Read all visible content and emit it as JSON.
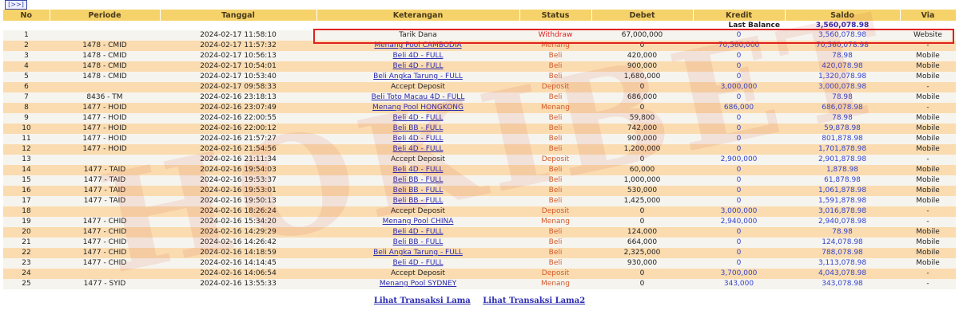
{
  "nav": {
    "label": "[>>]"
  },
  "columns": [
    "No",
    "Periode",
    "Tanggal",
    "Keterangan",
    "Status",
    "Debet",
    "Kredit",
    "Saldo",
    "Via"
  ],
  "last_balance": {
    "label": "Last Balance",
    "value": "3,560,078.98"
  },
  "rows": [
    {
      "no": "1",
      "periode": "",
      "tanggal": "2024-02-17 11:58:10",
      "ket": "Tarik Dana",
      "link": false,
      "status": "Withdraw",
      "debet": "67,000,000",
      "kredit": "0",
      "saldo": "3,560,078.98",
      "via": "Website"
    },
    {
      "no": "2",
      "periode": "1478 - CMID",
      "tanggal": "2024-02-17 11:57:32",
      "ket": "Menang Pool CAMBODIA",
      "link": true,
      "status": "Menang",
      "debet": "0",
      "kredit": "70,560,000",
      "saldo": "70,560,078.98",
      "via": "-"
    },
    {
      "no": "3",
      "periode": "1478 - CMID",
      "tanggal": "2024-02-17 10:56:13",
      "ket": "Beli 4D - FULL",
      "link": true,
      "status": "Beli",
      "debet": "420,000",
      "kredit": "0",
      "saldo": "78.98",
      "via": "Mobile"
    },
    {
      "no": "4",
      "periode": "1478 - CMID",
      "tanggal": "2024-02-17 10:54:01",
      "ket": "Beli 4D - FULL",
      "link": true,
      "status": "Beli",
      "debet": "900,000",
      "kredit": "0",
      "saldo": "420,078.98",
      "via": "Mobile"
    },
    {
      "no": "5",
      "periode": "1478 - CMID",
      "tanggal": "2024-02-17 10:53:40",
      "ket": "Beli Angka Tarung - FULL",
      "link": true,
      "status": "Beli",
      "debet": "1,680,000",
      "kredit": "0",
      "saldo": "1,320,078.98",
      "via": "Mobile"
    },
    {
      "no": "6",
      "periode": "",
      "tanggal": "2024-02-17 09:58:33",
      "ket": "Accept Deposit",
      "link": false,
      "status": "Deposit",
      "debet": "0",
      "kredit": "3,000,000",
      "saldo": "3,000,078.98",
      "via": "-"
    },
    {
      "no": "7",
      "periode": "8436 - TM",
      "tanggal": "2024-02-16 23:18:13",
      "ket": "Beli Toto Macau 4D - FULL",
      "link": true,
      "status": "Beli",
      "debet": "686,000",
      "kredit": "0",
      "saldo": "78.98",
      "via": "Mobile"
    },
    {
      "no": "8",
      "periode": "1477 - HOID",
      "tanggal": "2024-02-16 23:07:49",
      "ket": "Menang Pool HONGKONG",
      "link": true,
      "status": "Menang",
      "debet": "0",
      "kredit": "686,000",
      "saldo": "686,078.98",
      "via": "-"
    },
    {
      "no": "9",
      "periode": "1477 - HOID",
      "tanggal": "2024-02-16 22:00:55",
      "ket": "Beli 4D - FULL",
      "link": true,
      "status": "Beli",
      "debet": "59,800",
      "kredit": "0",
      "saldo": "78.98",
      "via": "Mobile"
    },
    {
      "no": "10",
      "periode": "1477 - HOID",
      "tanggal": "2024-02-16 22:00:12",
      "ket": "Beli BB - FULL",
      "link": true,
      "status": "Beli",
      "debet": "742,000",
      "kredit": "0",
      "saldo": "59,878.98",
      "via": "Mobile"
    },
    {
      "no": "11",
      "periode": "1477 - HOID",
      "tanggal": "2024-02-16 21:57:27",
      "ket": "Beli 4D - FULL",
      "link": true,
      "status": "Beli",
      "debet": "900,000",
      "kredit": "0",
      "saldo": "801,878.98",
      "via": "Mobile"
    },
    {
      "no": "12",
      "periode": "1477 - HOID",
      "tanggal": "2024-02-16 21:54:56",
      "ket": "Beli 4D - FULL",
      "link": true,
      "status": "Beli",
      "debet": "1,200,000",
      "kredit": "0",
      "saldo": "1,701,878.98",
      "via": "Mobile"
    },
    {
      "no": "13",
      "periode": "",
      "tanggal": "2024-02-16 21:11:34",
      "ket": "Accept Deposit",
      "link": false,
      "status": "Deposit",
      "debet": "0",
      "kredit": "2,900,000",
      "saldo": "2,901,878.98",
      "via": "-"
    },
    {
      "no": "14",
      "periode": "1477 - TAID",
      "tanggal": "2024-02-16 19:54:03",
      "ket": "Beli 4D - FULL",
      "link": true,
      "status": "Beli",
      "debet": "60,000",
      "kredit": "0",
      "saldo": "1,878.98",
      "via": "Mobile"
    },
    {
      "no": "15",
      "periode": "1477 - TAID",
      "tanggal": "2024-02-16 19:53:37",
      "ket": "Beli BB - FULL",
      "link": true,
      "status": "Beli",
      "debet": "1,000,000",
      "kredit": "0",
      "saldo": "61,878.98",
      "via": "Mobile"
    },
    {
      "no": "16",
      "periode": "1477 - TAID",
      "tanggal": "2024-02-16 19:53:01",
      "ket": "Beli BB - FULL",
      "link": true,
      "status": "Beli",
      "debet": "530,000",
      "kredit": "0",
      "saldo": "1,061,878.98",
      "via": "Mobile"
    },
    {
      "no": "17",
      "periode": "1477 - TAID",
      "tanggal": "2024-02-16 19:50:13",
      "ket": "Beli BB - FULL",
      "link": true,
      "status": "Beli",
      "debet": "1,425,000",
      "kredit": "0",
      "saldo": "1,591,878.98",
      "via": "Mobile"
    },
    {
      "no": "18",
      "periode": "",
      "tanggal": "2024-02-16 18:26:24",
      "ket": "Accept Deposit",
      "link": false,
      "status": "Deposit",
      "debet": "0",
      "kredit": "3,000,000",
      "saldo": "3,016,878.98",
      "via": "-"
    },
    {
      "no": "19",
      "periode": "1477 - CHID",
      "tanggal": "2024-02-16 15:34:20",
      "ket": "Menang Pool CHINA",
      "link": true,
      "status": "Menang",
      "debet": "0",
      "kredit": "2,940,000",
      "saldo": "2,940,078.98",
      "via": "-"
    },
    {
      "no": "20",
      "periode": "1477 - CHID",
      "tanggal": "2024-02-16 14:29:29",
      "ket": "Beli 4D - FULL",
      "link": true,
      "status": "Beli",
      "debet": "124,000",
      "kredit": "0",
      "saldo": "78.98",
      "via": "Mobile"
    },
    {
      "no": "21",
      "periode": "1477 - CHID",
      "tanggal": "2024-02-16 14:26:42",
      "ket": "Beli BB - FULL",
      "link": true,
      "status": "Beli",
      "debet": "664,000",
      "kredit": "0",
      "saldo": "124,078.98",
      "via": "Mobile"
    },
    {
      "no": "22",
      "periode": "1477 - CHID",
      "tanggal": "2024-02-16 14:18:59",
      "ket": "Beli Angka Tarung - FULL",
      "link": true,
      "status": "Beli",
      "debet": "2,325,000",
      "kredit": "0",
      "saldo": "788,078.98",
      "via": "Mobile"
    },
    {
      "no": "23",
      "periode": "1477 - CHID",
      "tanggal": "2024-02-16 14:14:45",
      "ket": "Beli 4D - FULL",
      "link": true,
      "status": "Beli",
      "debet": "930,000",
      "kredit": "0",
      "saldo": "3,113,078.98",
      "via": "Mobile"
    },
    {
      "no": "24",
      "periode": "",
      "tanggal": "2024-02-16 14:06:54",
      "ket": "Accept Deposit",
      "link": false,
      "status": "Deposit",
      "debet": "0",
      "kredit": "3,700,000",
      "saldo": "4,043,078.98",
      "via": "-"
    },
    {
      "no": "25",
      "periode": "1477 - SYID",
      "tanggal": "2024-02-16 13:55:33",
      "ket": "Menang Pool SYDNEY",
      "link": true,
      "status": "Menang",
      "debet": "0",
      "kredit": "343,000",
      "saldo": "343,078.98",
      "via": "-"
    }
  ],
  "footer": {
    "link1": "Lihat Transaksi Lama",
    "link2": "Lihat Transaksi Lama2"
  },
  "colors": {
    "header": "#f5d36a",
    "row_alt": "#fbdcb0",
    "row": "#f6f4ee",
    "highlight": "#e02020",
    "link": "#2b2bb0"
  }
}
